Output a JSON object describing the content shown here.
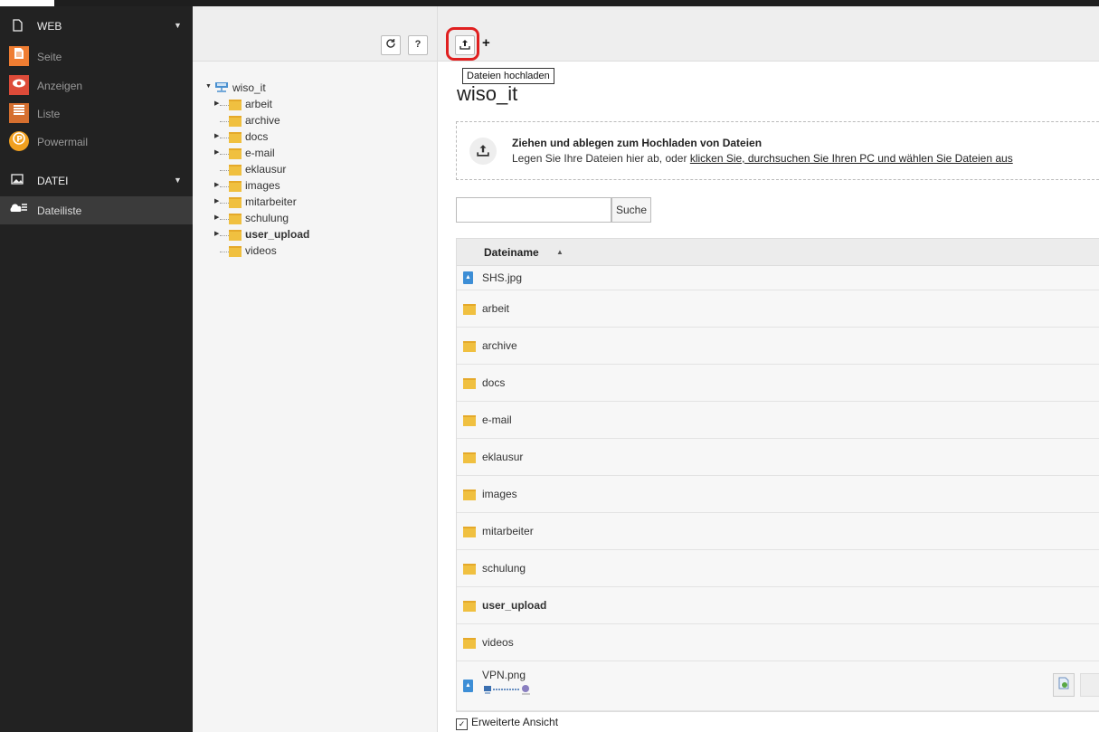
{
  "colors": {
    "sidebar_bg": "#222222",
    "seite_icon": "#ef7d32",
    "anzeigen_icon": "#dd4b39",
    "liste_icon": "#d56f2f",
    "powermail_icon": "#f0a020",
    "dateiliste_icon": "#5b9e4a",
    "highlight_ring": "#e02020",
    "folder": "#f0c040",
    "file_icon": "#3d8ed6"
  },
  "sidebar": {
    "groups": [
      {
        "label": "WEB",
        "icon": "page-icon"
      },
      {
        "label": "DATEI",
        "icon": "image-icon"
      }
    ],
    "web_modules": [
      {
        "label": "Seite",
        "icon": "page-module-icon"
      },
      {
        "label": "Anzeigen",
        "icon": "eye-icon"
      },
      {
        "label": "Liste",
        "icon": "list-icon"
      },
      {
        "label": "Powermail",
        "icon": "powermail-icon"
      }
    ],
    "datei_modules": [
      {
        "label": "Dateiliste",
        "icon": "filelist-icon",
        "active": true
      }
    ]
  },
  "tree": {
    "toolbar": {
      "refresh_icon": "refresh-icon",
      "help_label": "?"
    },
    "root": "wiso_it",
    "items": [
      {
        "label": "arbeit",
        "expandable": true
      },
      {
        "label": "archive",
        "expandable": false
      },
      {
        "label": "docs",
        "expandable": true
      },
      {
        "label": "e-mail",
        "expandable": true
      },
      {
        "label": "eklausur",
        "expandable": false
      },
      {
        "label": "images",
        "expandable": true
      },
      {
        "label": "mitarbeiter",
        "expandable": true
      },
      {
        "label": "schulung",
        "expandable": true
      },
      {
        "label": "user_upload",
        "expandable": true,
        "bold": true
      },
      {
        "label": "videos",
        "expandable": false
      }
    ]
  },
  "main": {
    "toolbar": {
      "upload_icon": "upload-icon",
      "plus_label": "+"
    },
    "tooltip": "Dateien hochladen",
    "title": "wiso_it",
    "dropzone": {
      "heading": "Ziehen und ablegen zum Hochladen von Dateien",
      "text_prefix": "Legen Sie Ihre Dateien hier ab, oder ",
      "link": "klicken Sie, durchsuchen Sie Ihren PC und wählen Sie Dateien aus"
    },
    "search": {
      "placeholder": "",
      "button": "Suche"
    },
    "table": {
      "header": "Dateiname",
      "sort_indicator": "▲",
      "rows": [
        {
          "name": "SHS.jpg",
          "type": "file"
        },
        {
          "name": "arbeit",
          "type": "folder"
        },
        {
          "name": "archive",
          "type": "folder"
        },
        {
          "name": "docs",
          "type": "folder"
        },
        {
          "name": "e-mail",
          "type": "folder"
        },
        {
          "name": "eklausur",
          "type": "folder"
        },
        {
          "name": "images",
          "type": "folder"
        },
        {
          "name": "mitarbeiter",
          "type": "folder"
        },
        {
          "name": "schulung",
          "type": "folder"
        },
        {
          "name": "user_upload",
          "type": "folder",
          "bold": true
        },
        {
          "name": "videos",
          "type": "folder"
        },
        {
          "name": "VPN.png",
          "type": "file"
        }
      ]
    },
    "extended_view": {
      "label": "Erweiterte Ansicht",
      "checked": true
    }
  }
}
